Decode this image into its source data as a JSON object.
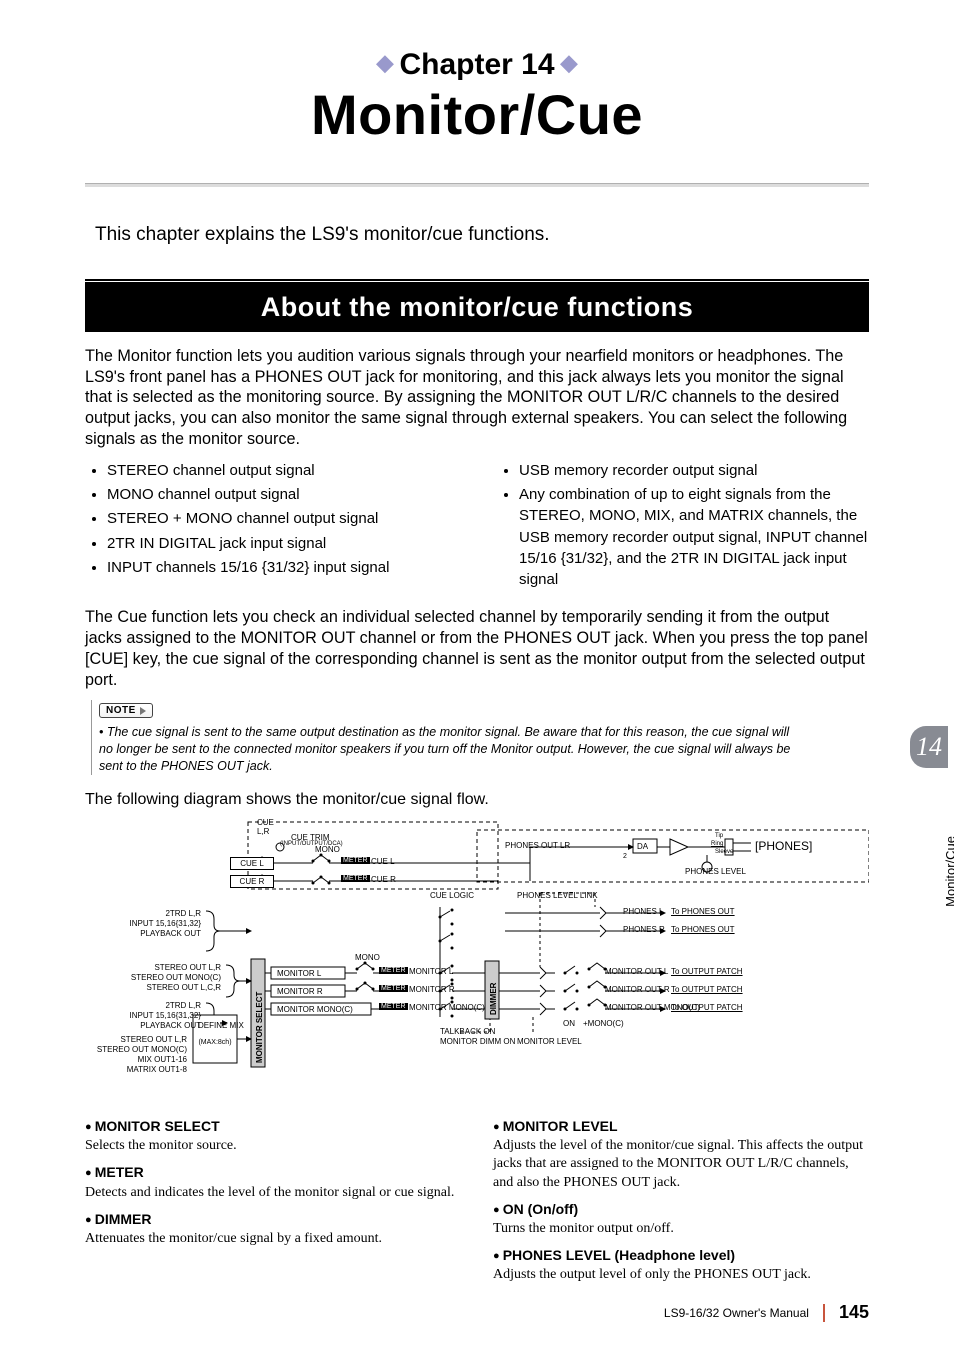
{
  "chapter": {
    "prefix": "Chapter 14"
  },
  "title": "Monitor/Cue",
  "intro": "This chapter explains the LS9's monitor/cue functions.",
  "section_heading": "About the monitor/cue functions",
  "para1": "The Monitor function lets you audition various signals through your nearfield monitors or headphones. The LS9's front panel has a PHONES OUT jack for monitoring, and this jack always lets you monitor the signal that is selected as the monitoring source. By assigning the MONITOR OUT L/R/C channels to the desired output jacks, you can also monitor the same signal through external speakers. You can select the following signals as the monitor source.",
  "bullets_left": [
    "STEREO channel output signal",
    "MONO channel output signal",
    "STEREO + MONO channel output signal",
    "2TR IN DIGITAL jack input signal",
    "INPUT channels 15/16 {31/32} input signal"
  ],
  "bullets_right": [
    "USB memory recorder output signal",
    "Any combination of up to eight signals from the STEREO, MONO, MIX, and MATRIX channels, the USB memory recorder output signal, INPUT channel 15/16 {31/32}, and the 2TR IN DIGITAL jack input signal"
  ],
  "para2": "The Cue function lets you check an individual selected channel by temporarily sending it from the output jacks assigned to the MONITOR OUT channel or from the PHONES OUT jack. When you press the top panel [CUE] key, the cue signal of the corresponding channel is sent as the monitor output from the selected output port.",
  "note_label": "NOTE",
  "note_text": "• The cue signal is sent to the same output destination as the monitor signal. Be aware that for this reason, the cue signal will no longer be sent to the connected monitor speakers if you turn off the Monitor output. However, the cue signal will always be sent to the PHONES OUT jack.",
  "diagram_caption": "The following diagram shows the monitor/cue signal flow.",
  "diagram": {
    "cue_header": "CUE",
    "cue_lr": "L,R",
    "cue_trim": "CUE TRIM",
    "cue_trim_sub": "(INPUT/OUTPUT/DCA)",
    "cue_l": "CUE L",
    "cue_r": "CUE R",
    "meter": "METER",
    "meter_cue_l": "CUE L",
    "meter_cue_r": "CUE R",
    "mono_top": "MONO",
    "inputs_block1": [
      "2TRD L,R",
      "INPUT 15,16{31,32}",
      "PLAYBACK OUT"
    ],
    "inputs_block2": [
      "STEREO OUT L,R",
      "STEREO OUT MONO(C)",
      "STEREO OUT L,C,R"
    ],
    "inputs_block3": [
      "2TRD L,R",
      "INPUT 15,16{31,32}",
      "PLAYBACK OUT"
    ],
    "inputs_block4": [
      "STEREO OUT L,R",
      "STEREO OUT MONO(C)",
      "MIX OUT1-16",
      "MATRIX OUT1-8"
    ],
    "define_mix": "DEFINE MIX",
    "define_mix_sub": "(MAX:8ch)",
    "monitor_select": "MONITOR SELECT",
    "monitor_l": "MONITOR L",
    "monitor_r": "MONITOR R",
    "monitor_mono": "MONITOR MONO(C)",
    "mono_mid": "MONO",
    "meter_mon_l": "MONITOR L",
    "meter_mon_r": "MONITOR R",
    "meter_mon_mono": "MONITOR MONO(C)",
    "cue_logic": "CUE LOGIC",
    "talkback_on": "TALKBACK ON",
    "monitor_dimm_on": "MONITOR DIMM ON",
    "dimmer": "DIMMER",
    "monitor_level": "MONITOR LEVEL",
    "on": "ON",
    "mono_bottom": "+MONO(C)",
    "phones_level_link": "PHONES LEVEL LINK",
    "phones_l": "PHONES L",
    "phones_r": "PHONES R",
    "to_phones_out": "To PHONES OUT",
    "monitor_out_l": "MONITOR OUT L",
    "monitor_out_r": "MONITOR OUT R",
    "monitor_out_mono": "MONITOR OUT MONO(C)",
    "to_output_patch": "To OUTPUT PATCH",
    "phones_out_lr": "PHONES OUT LR",
    "da": "DA",
    "tip": "Tip",
    "ring": "Ring",
    "sleeve": "Sleeve",
    "phones_jack": "[PHONES]",
    "phones_level": "PHONES LEVEL",
    "two": "2"
  },
  "glossary_left": [
    {
      "head": "MONITOR SELECT",
      "body": "Selects the monitor source."
    },
    {
      "head": "METER",
      "body": "Detects and indicates the level of the monitor signal or cue signal."
    },
    {
      "head": "DIMMER",
      "body": "Attenuates the monitor/cue signal by a fixed amount."
    }
  ],
  "glossary_right": [
    {
      "head": "MONITOR LEVEL",
      "body": "Adjusts the level of the monitor/cue signal. This affects the output jacks that are assigned to the MONITOR OUT L/R/C channels, and also the PHONES OUT jack."
    },
    {
      "head": "ON (On/off)",
      "body": "Turns the monitor output on/off."
    },
    {
      "head": "PHONES LEVEL (Headphone level)",
      "body": "Adjusts the output level of only the PHONES OUT jack."
    }
  ],
  "side_tab_number": "14",
  "side_label": "Monitor/Cue",
  "footer_manual": "LS9-16/32  Owner's Manual",
  "footer_page": "145"
}
